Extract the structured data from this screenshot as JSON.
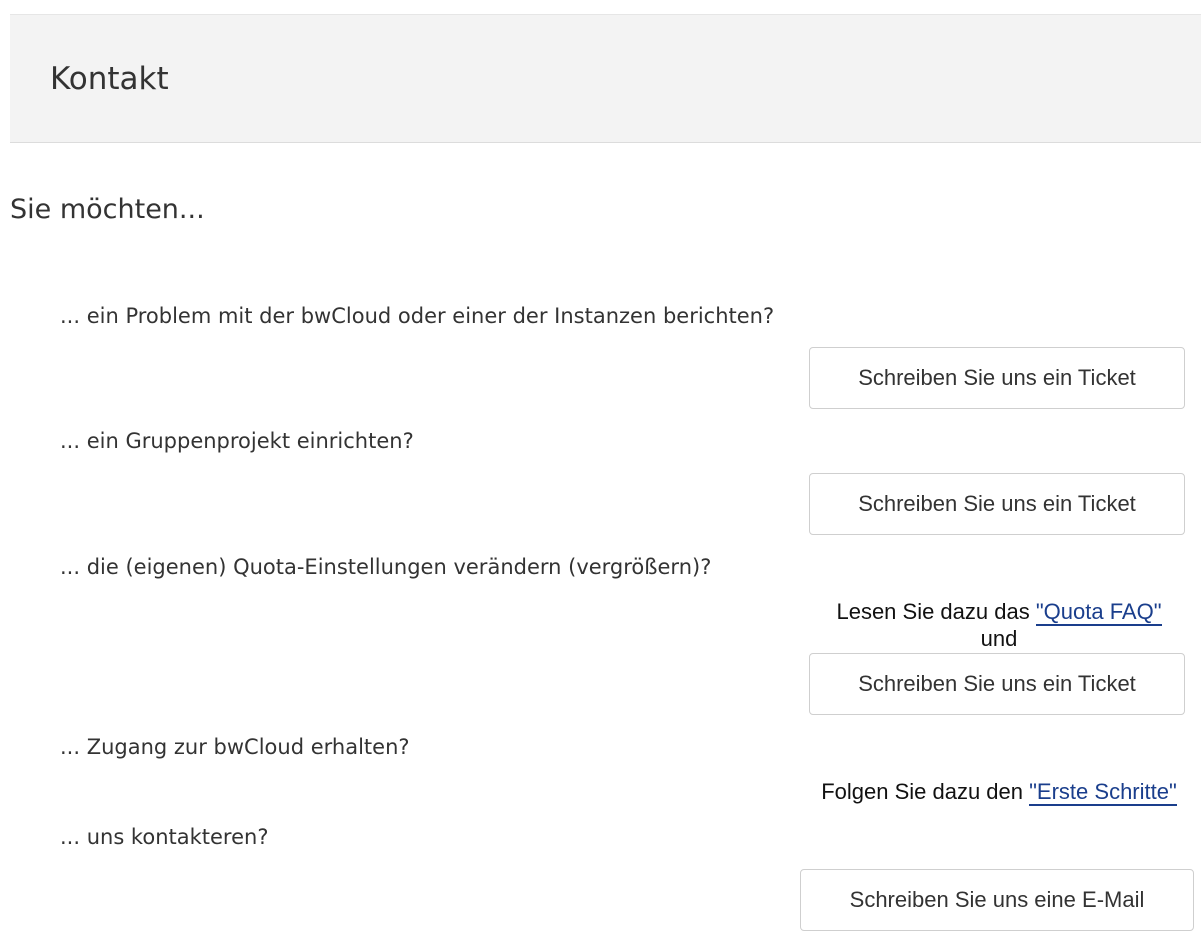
{
  "header": {
    "title": "Kontakt"
  },
  "subtitle": "Sie möchten...",
  "sections": [
    {
      "question": "... ein Problem mit der bwCloud oder einer der Instanzen berichten?",
      "button_label": "Schreiben Sie uns ein Ticket"
    },
    {
      "question": "... ein Gruppenprojekt einrichten?",
      "button_label": "Schreiben Sie uns ein Ticket"
    },
    {
      "question": "... die (eigenen) Quota-Einstellungen verändern (vergrößern)?",
      "info_prefix": "Lesen Sie dazu das ",
      "link_label": "\"Quota FAQ\"",
      "info_suffix": "und",
      "button_label": "Schreiben Sie uns ein Ticket"
    },
    {
      "question": "... Zugang zur bwCloud erhalten?",
      "info_prefix": "Folgen Sie dazu den ",
      "link_label": "\"Erste Schritte\""
    },
    {
      "question": "... uns kontakteren?",
      "button_label": "Schreiben Sie uns eine E-Mail"
    }
  ],
  "colors": {
    "header_bg": "#f3f3f3",
    "link": "#1a3e8c",
    "text": "#333333"
  }
}
